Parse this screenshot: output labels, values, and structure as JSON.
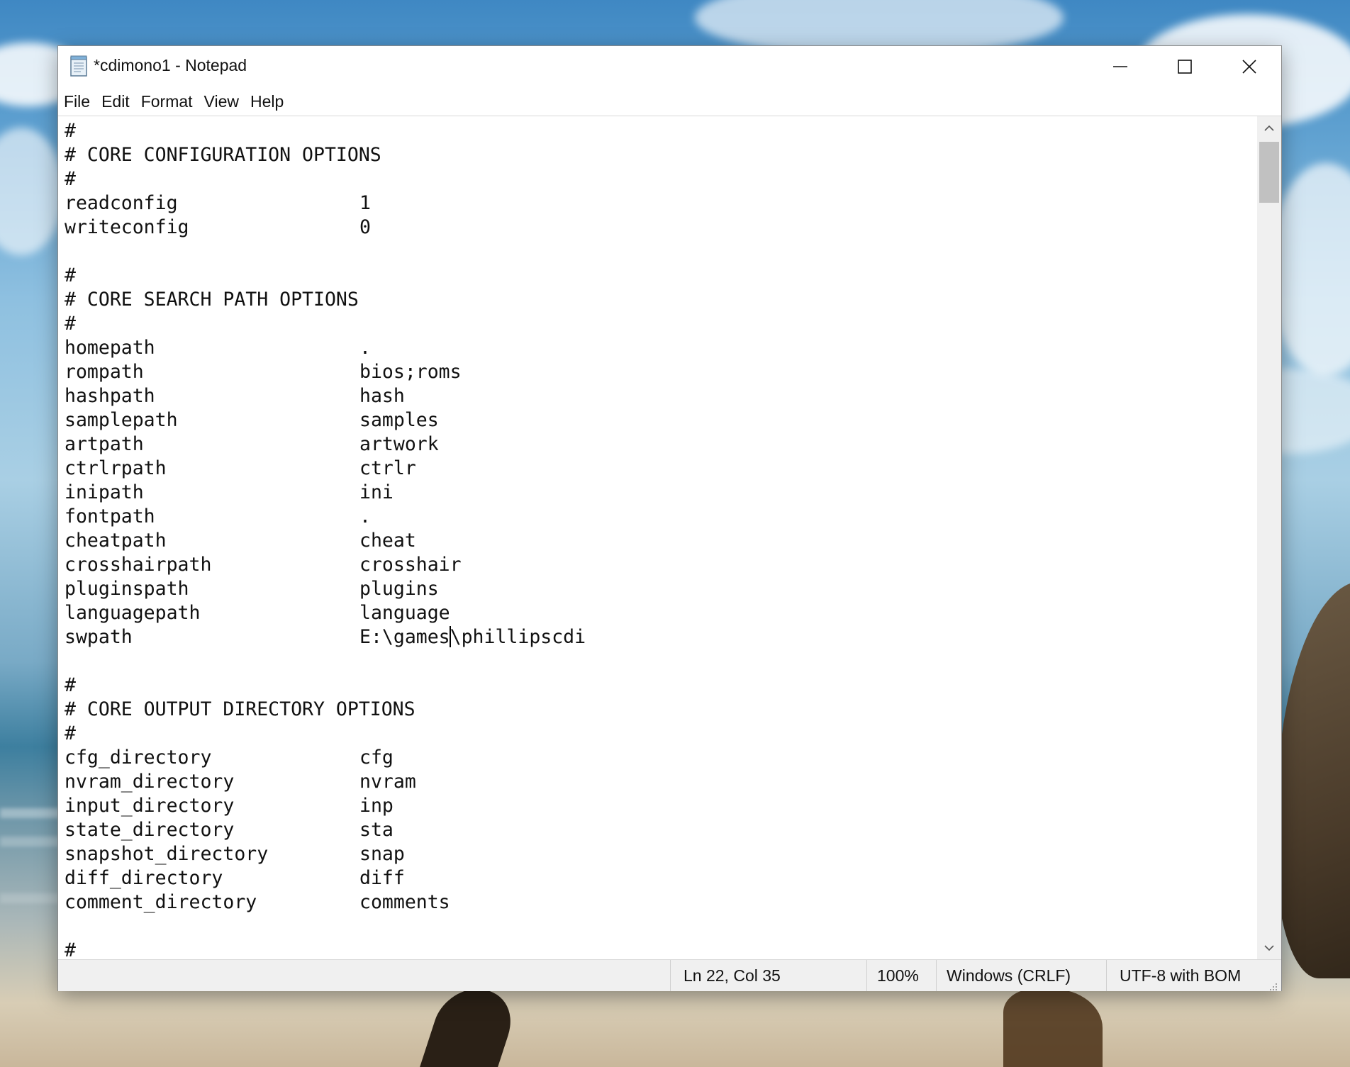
{
  "window": {
    "title": "*cdimono1 - Notepad"
  },
  "menu": [
    "File",
    "Edit",
    "Format",
    "View",
    "Help"
  ],
  "editor": {
    "lines": [
      {
        "k": "#",
        "v": ""
      },
      {
        "k": "# CORE CONFIGURATION OPTIONS",
        "v": ""
      },
      {
        "k": "#",
        "v": ""
      },
      {
        "k": "readconfig",
        "v": "1"
      },
      {
        "k": "writeconfig",
        "v": "0"
      },
      {
        "k": "",
        "v": ""
      },
      {
        "k": "#",
        "v": ""
      },
      {
        "k": "# CORE SEARCH PATH OPTIONS",
        "v": ""
      },
      {
        "k": "#",
        "v": ""
      },
      {
        "k": "homepath",
        "v": "."
      },
      {
        "k": "rompath",
        "v": "bios;roms"
      },
      {
        "k": "hashpath",
        "v": "hash"
      },
      {
        "k": "samplepath",
        "v": "samples"
      },
      {
        "k": "artpath",
        "v": "artwork"
      },
      {
        "k": "ctrlrpath",
        "v": "ctrlr"
      },
      {
        "k": "inipath",
        "v": "ini"
      },
      {
        "k": "fontpath",
        "v": "."
      },
      {
        "k": "cheatpath",
        "v": "cheat"
      },
      {
        "k": "crosshairpath",
        "v": "crosshair"
      },
      {
        "k": "pluginspath",
        "v": "plugins"
      },
      {
        "k": "languagepath",
        "v": "language"
      },
      {
        "k": "swpath",
        "v": "E:\\games",
        "v2": "\\phillipscdi",
        "caret": true
      },
      {
        "k": "",
        "v": ""
      },
      {
        "k": "#",
        "v": ""
      },
      {
        "k": "# CORE OUTPUT DIRECTORY OPTIONS",
        "v": ""
      },
      {
        "k": "#",
        "v": ""
      },
      {
        "k": "cfg_directory",
        "v": "cfg"
      },
      {
        "k": "nvram_directory",
        "v": "nvram"
      },
      {
        "k": "input_directory",
        "v": "inp"
      },
      {
        "k": "state_directory",
        "v": "sta"
      },
      {
        "k": "snapshot_directory",
        "v": "snap"
      },
      {
        "k": "diff_directory",
        "v": "diff"
      },
      {
        "k": "comment_directory",
        "v": "comments"
      },
      {
        "k": "",
        "v": ""
      },
      {
        "k": "#",
        "v": ""
      }
    ]
  },
  "status": {
    "position": "Ln 22, Col 35",
    "zoom": "100%",
    "line_ending": "Windows (CRLF)",
    "encoding": "UTF-8 with BOM"
  },
  "icons": {
    "app": "notepad-icon",
    "minimize": "minimize-icon",
    "maximize": "maximize-icon",
    "close": "close-icon",
    "scroll_up": "chevron-up-icon",
    "scroll_down": "chevron-down-icon",
    "grip": "resize-grip-icon"
  }
}
